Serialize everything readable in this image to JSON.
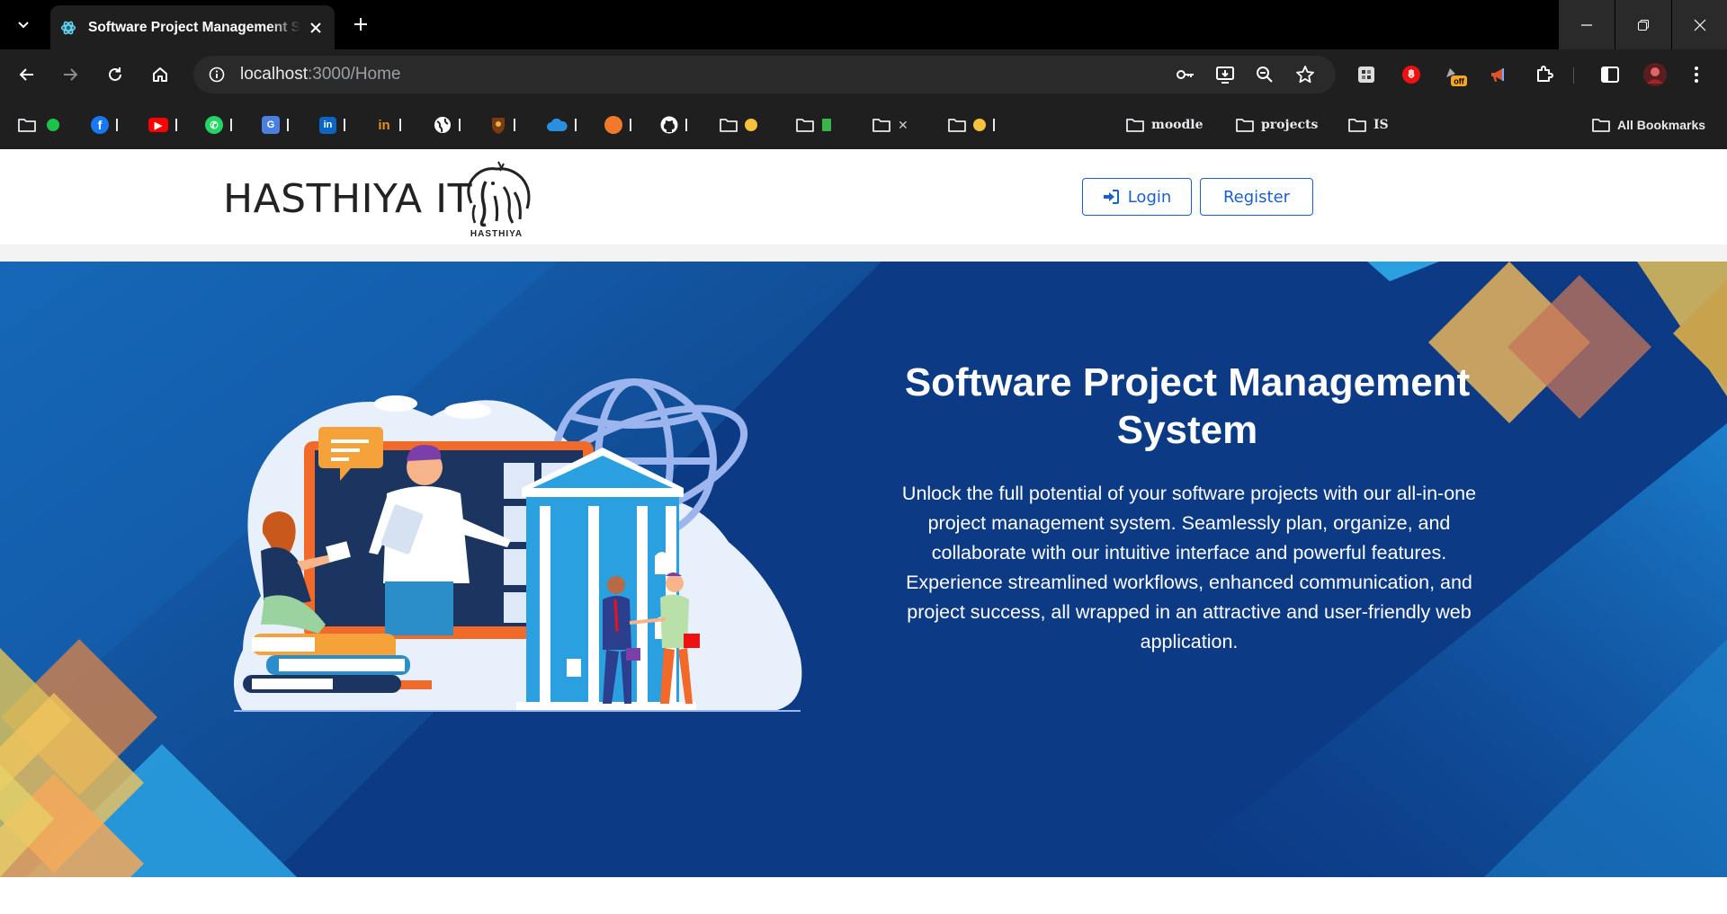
{
  "browser": {
    "tab_title": "Software Project Management Sy",
    "url_host": "localhost",
    "url_path": ":3000/Home",
    "bookmarks": [
      {
        "name": "moodle"
      },
      {
        "name": "projects"
      },
      {
        "name": "IS"
      }
    ],
    "all_bookmarks_label": "All Bookmarks",
    "extension_badge": "off"
  },
  "header": {
    "brand": "HASTHIYA IT",
    "logo_caption": "HASTHIYA",
    "login_label": "Login",
    "register_label": "Register"
  },
  "hero": {
    "title": "Software Project Management System",
    "description": "Unlock the full potential of your software projects with our all-in-one project management system. Seamlessly plan, organize, and collaborate with our intuitive interface and powerful features. Experience streamlined workflows, enhanced communication, and project success, all wrapped in an attractive and user-friendly web application."
  },
  "colors": {
    "hero_bg": "#0d3a83",
    "accent": "#1a5fd0"
  }
}
